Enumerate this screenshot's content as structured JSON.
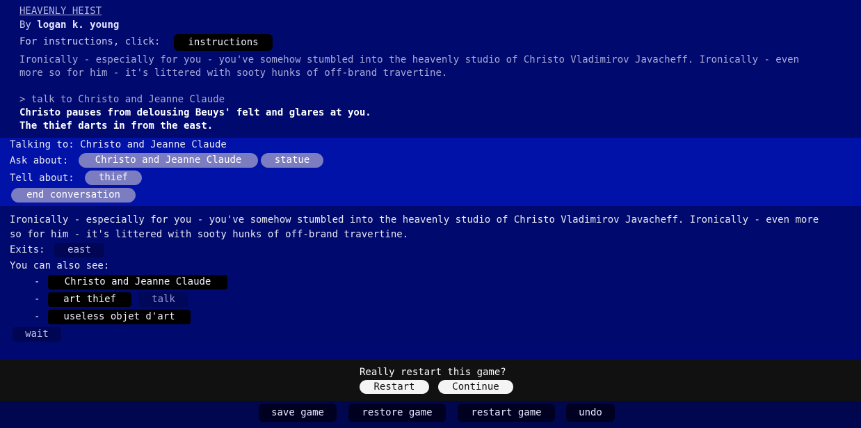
{
  "header": {
    "title": "HEAVENLY HEIST",
    "by_prefix": "By ",
    "author": "logan k. young",
    "instructions_prompt": "For instructions, click:",
    "instructions_button": "instructions"
  },
  "transcript": {
    "intro_line1": "Ironically - especially for you - you've somehow stumbled into the heavenly studio of Christo Vladimirov Javacheff. Ironically - even",
    "intro_line2": "more so for him - it's littered with sooty hunks of off-brand travertine.",
    "command": "> talk to Christo and Jeanne Claude",
    "response_line1": "Christo pauses from delousing Beuys' felt and glares at you.",
    "response_line2": "The thief darts in from the east."
  },
  "conversation": {
    "talking_to_label": "Talking to: Christo and Jeanne Claude",
    "ask_label": "Ask about:",
    "ask_topics": [
      "Christo and Jeanne Claude",
      "statue"
    ],
    "tell_label": "Tell about:",
    "tell_topics": [
      "thief"
    ],
    "end_button": "end conversation"
  },
  "room": {
    "desc_line1": "Ironically - especially for you - you've somehow stumbled into the heavenly studio of Christo Vladimirov Javacheff. Ironically - even more",
    "desc_line2": "so for him - it's littered with sooty hunks of off-brand travertine.",
    "exits_label": "Exits:",
    "exits": [
      "east"
    ],
    "see_label": "You can also see:",
    "bullet": "-",
    "objects": [
      {
        "name": "Christo and Jeanne Claude",
        "action": ""
      },
      {
        "name": "art thief",
        "action": "talk"
      },
      {
        "name": "useless objet d'art",
        "action": ""
      }
    ],
    "wait_button": "wait"
  },
  "dialog": {
    "question": "Really restart this game?",
    "restart_button": "Restart",
    "continue_button": "Continue"
  },
  "toolbar": {
    "save": "save game",
    "restore": "restore game",
    "restart": "restart game",
    "undo": "undo"
  }
}
